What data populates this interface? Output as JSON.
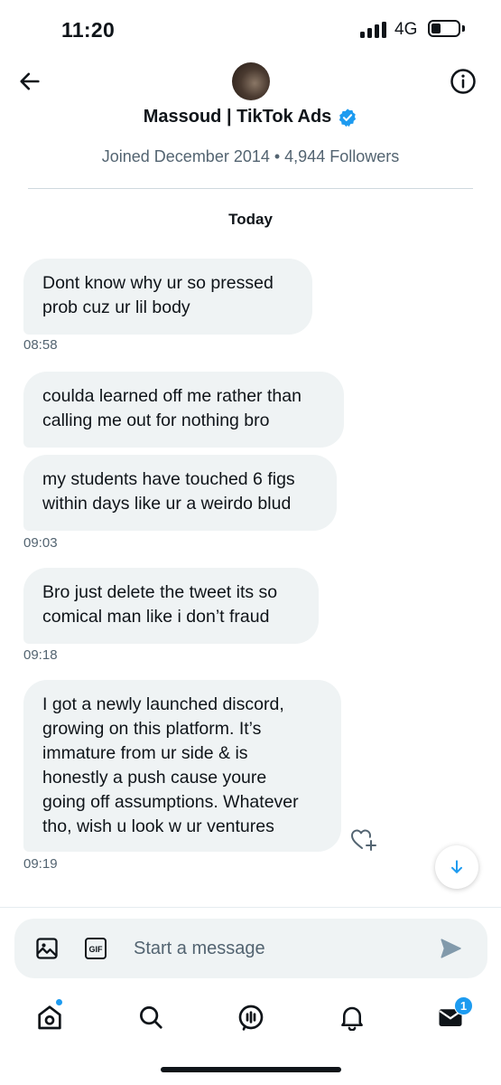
{
  "status_bar": {
    "time": "11:20",
    "network": "4G",
    "battery_level": 0.3
  },
  "header": {
    "back_icon": "arrow-left-icon",
    "info_icon": "info-icon",
    "name": "Massoud | TikTok Ads",
    "verified_icon": "verified-badge-icon",
    "meta": "Joined December 2014 • 4,944 Followers"
  },
  "conversation": {
    "day_label": "Today",
    "messages": [
      {
        "line1": "Dont know why ur so pressed",
        "line2": "prob cuz ur lil body"
      },
      {
        "line1": "coulda learned off me rather than",
        "line2": "calling me out for nothing bro"
      },
      {
        "line1": "my students have touched 6 figs",
        "line2": "within days like ur a weirdo blud"
      },
      {
        "line1": "Bro just delete the tweet its so",
        "line2": "comical man like i don’t fraud"
      },
      {
        "lines": [
          "I got a newly launched discord,",
          "growing on this platform. It’s",
          "immature from ur side & is",
          "honestly a push cause youre",
          "going off assumptions. Whatever",
          "tho, wish u look w ur ventures"
        ]
      }
    ],
    "timestamps": [
      "08:58",
      "09:03",
      "09:18",
      "09:19"
    ]
  },
  "composer": {
    "placeholder": "Start a message",
    "gif_label": "GIF"
  },
  "nav": {
    "items": [
      "home-icon",
      "search-icon",
      "spaces-icon",
      "notifications-icon",
      "messages-icon"
    ],
    "messages_badge": "1"
  },
  "colors": {
    "accent": "#1d9bf0",
    "bubble": "#eff3f4",
    "text": "#0f1419",
    "muted": "#536471"
  }
}
